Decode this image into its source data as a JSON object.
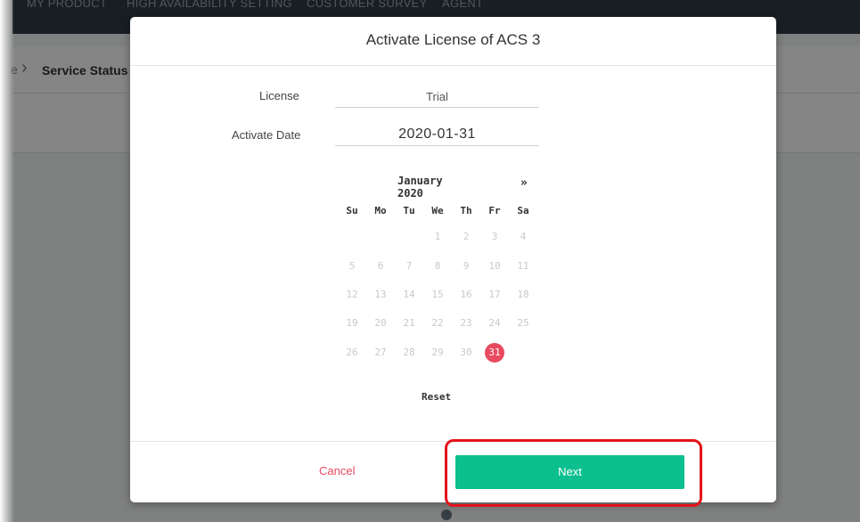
{
  "background": {
    "top_nav": [
      "MY PRODUCT",
      "HIGH AVAILABILITY SETTING",
      "CUSTOMER SURVEY",
      "AGENT"
    ],
    "breadcrumb": {
      "previous": "e",
      "current": "Service Status"
    }
  },
  "modal": {
    "title": "Activate License of ACS 3",
    "license_label": "License",
    "license_value": "Trial",
    "activate_date_label": "Activate Date",
    "activate_date_value": "2020-01-31",
    "calendar": {
      "month_label": "January 2020",
      "next_nav": "»",
      "weekdays": [
        "Su",
        "Mo",
        "Tu",
        "We",
        "Th",
        "Fr",
        "Sa"
      ],
      "selected_day": "31",
      "reset_label": "Reset",
      "weeks": [
        [
          "",
          "",
          "",
          "1",
          "2",
          "3",
          "4"
        ],
        [
          "5",
          "6",
          "7",
          "8",
          "9",
          "10",
          "11"
        ],
        [
          "12",
          "13",
          "14",
          "15",
          "16",
          "17",
          "18"
        ],
        [
          "19",
          "20",
          "21",
          "22",
          "23",
          "24",
          "25"
        ],
        [
          "26",
          "27",
          "28",
          "29",
          "30",
          "31",
          ""
        ]
      ]
    },
    "cancel_label": "Cancel",
    "next_label": "Next"
  },
  "colors": {
    "accent_green": "#0cbf8f",
    "cancel_red": "#e84a5f",
    "selected_day": "#e84a5f",
    "highlight_red": "#e3131b"
  }
}
